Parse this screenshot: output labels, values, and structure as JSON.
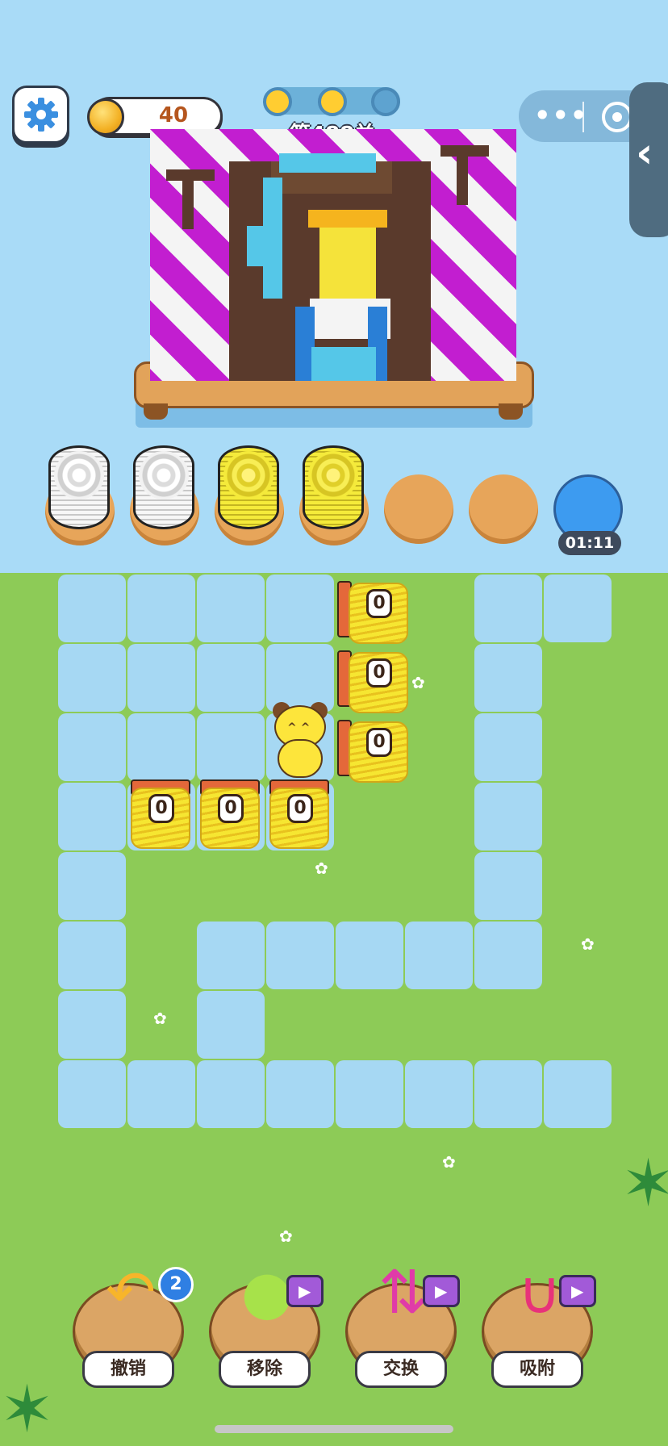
{
  "header": {
    "coins": "40",
    "level_label": "第488关",
    "progress": {
      "completed": 2,
      "total": 3
    },
    "menu_dots": "•••"
  },
  "slots": {
    "timer": "01:11",
    "spools": [
      "white",
      "white",
      "yellow",
      "yellow",
      "empty",
      "empty",
      "blue"
    ]
  },
  "board": {
    "yarn_count": "0"
  },
  "tools": [
    {
      "label": "撤销",
      "badge": "2",
      "icon": "undo-arrow-icon"
    },
    {
      "label": "移除",
      "icon": "remove-ball-icon"
    },
    {
      "label": "交换",
      "icon": "swap-arrows-icon"
    },
    {
      "label": "吸附",
      "icon": "magnet-icon"
    }
  ],
  "colors": {
    "sky": "#a9dbf7",
    "grass": "#8dcb57",
    "path": "#a6d8f3",
    "yarn_yellow": "#f6e631",
    "picture_magenta": "#c21ed0",
    "picture_brown": "#5a3a2c"
  }
}
